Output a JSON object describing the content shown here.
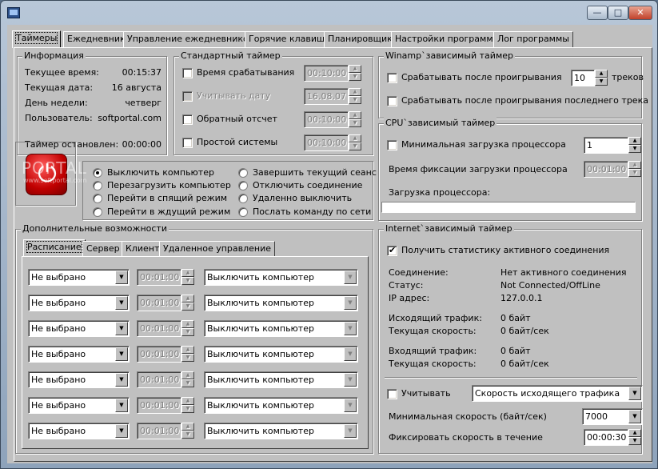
{
  "window": {
    "title": "",
    "min": "—",
    "max": "□",
    "close": "✕"
  },
  "tabs": [
    "Таймеры",
    "Ежедневник",
    "Управление ежедневником",
    "Горячие клавиши",
    "Планировщик",
    "Настройки программы",
    "Лог программы"
  ],
  "info": {
    "title": "Информация",
    "rows": [
      {
        "label": "Текущее время:",
        "value": "00:15:37"
      },
      {
        "label": "Текущая дата:",
        "value": "16 августа"
      },
      {
        "label": "День недели:",
        "value": "четверг"
      },
      {
        "label": "Пользователь:",
        "value": "softportal.com"
      }
    ],
    "stopped_label": "Таймер остановлен:",
    "stopped_value": "00:00:00"
  },
  "std_timer": {
    "title": "Стандартный таймер",
    "rows": [
      {
        "label": "Время срабатывания",
        "value": "00:10:00"
      },
      {
        "label": "Учитывать дату",
        "value": "16.08.07"
      },
      {
        "label": "Обратный отсчет",
        "value": "00:10:00"
      },
      {
        "label": "Простой системы",
        "value": "00:10:00"
      }
    ]
  },
  "actions": {
    "left": [
      "Выключить компьютер",
      "Перезагрузить компьютер",
      "Перейти в спящий режим",
      "Перейти в ждущий режим"
    ],
    "right": [
      "Завершить текущий сеанс",
      "Отключить соединение",
      "Удаленно выключить",
      "Послать команду по сети"
    ],
    "watermark": "PORTAL",
    "watermark_sub": "www.softportal.com"
  },
  "extra": {
    "title": "Дополнительные возможности",
    "subtabs": [
      "Расписание",
      "Сервер",
      "Клиент",
      "Удаленное управление"
    ],
    "rows": [
      {
        "day": "Не выбрано",
        "time": "00:01:00",
        "action": "Выключить компьютер"
      },
      {
        "day": "Не выбрано",
        "time": "00:01:00",
        "action": "Выключить компьютер"
      },
      {
        "day": "Не выбрано",
        "time": "00:01:00",
        "action": "Выключить компьютер"
      },
      {
        "day": "Не выбрано",
        "time": "00:01:00",
        "action": "Выключить компьютер"
      },
      {
        "day": "Не выбрано",
        "time": "00:01:00",
        "action": "Выключить компьютер"
      },
      {
        "day": "Не выбрано",
        "time": "00:01:00",
        "action": "Выключить компьютер"
      },
      {
        "day": "Не выбрано",
        "time": "00:01:00",
        "action": "Выключить компьютер"
      }
    ]
  },
  "winamp": {
    "title": "Winamp`зависимый таймер",
    "after_play": "Срабатывать после проигрывания",
    "tracks_value": "10",
    "tracks_label": "треков",
    "after_last": "Срабатывать после проигрывания последнего трека"
  },
  "cpu": {
    "title": "CPU`зависимый таймер",
    "min_load": "Минимальная загрузка процессора",
    "min_value": "1",
    "fix_time": "Время фиксации загрузки процессора",
    "fix_value": "00:01:00",
    "load_label": "Загрузка процессора:"
  },
  "internet": {
    "title": "Internet`зависимый таймер",
    "get_stats": "Получить статистику активного соединения",
    "rows": [
      {
        "label": "Соединение:",
        "value": "Нет активного соединения"
      },
      {
        "label": "Статус:",
        "value": "Not Connected/OffLine"
      },
      {
        "label": "IP адрес:",
        "value": "127.0.0.1"
      },
      {
        "label": "Исходящий трафик:",
        "value": "0 байт"
      },
      {
        "label": "Текущая скорость:",
        "value": "0 байт/сек"
      },
      {
        "label": "Входящий трафик:",
        "value": "0 байт"
      },
      {
        "label": "Текущая скорость:",
        "value": "0 байт/сек"
      }
    ],
    "consider": "Учитывать",
    "consider_option": "Скорость исходящего трафика",
    "min_speed_label": "Минимальная скорость (байт/сек)",
    "min_speed_value": "7000",
    "fix_speed_label": "Фиксировать скорость в течение",
    "fix_speed_value": "00:00:30"
  }
}
